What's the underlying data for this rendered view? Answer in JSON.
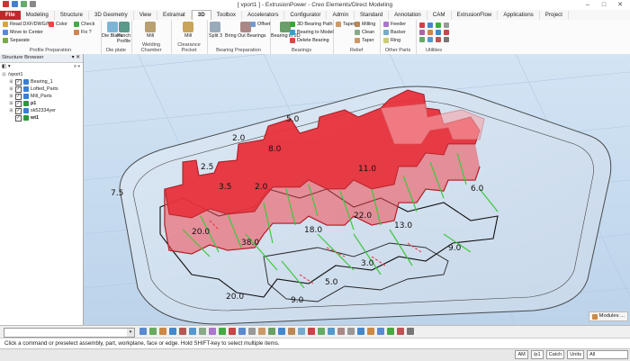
{
  "window": {
    "title": "[ vport1 ] - ExtrusionPower - Creo Elements/Direct Modeling",
    "controls": [
      "–",
      "□",
      "✕"
    ]
  },
  "menu_tabs": [
    "File",
    "Modeling",
    "Structure",
    "3D Geometry",
    "View",
    "Extramat",
    "3D",
    "Toolbox",
    "Accelerators",
    "Configurator",
    "Admin",
    "Standard",
    "Annotation",
    "CAM",
    "ExtrusionFlow",
    "Applications",
    "Project"
  ],
  "ribbon": {
    "profile_prep": {
      "label": "Profile Preparation",
      "items": [
        "Read DXF/DWG/MI",
        "Move to Center",
        "Separate"
      ],
      "color": "Color",
      "check": "Check",
      "fix": "Fix ?"
    },
    "die_plate": {
      "label": "Die plate",
      "buttons": [
        "Die Blank",
        "Punch Profile"
      ]
    },
    "welding": {
      "label": "Welding Chamber",
      "buttons": [
        "Mill"
      ]
    },
    "clearance": {
      "label": "Clearance Pocket",
      "buttons": [
        "Mill"
      ]
    },
    "bearing_prep": {
      "label": "Bearing Preparation",
      "buttons": [
        "Split 3",
        "Bring Out Bearings"
      ],
      "offset": "Offset"
    },
    "bearings": {
      "label": "Bearings",
      "items": [
        "3D Bearing Path",
        "Bearing to Model",
        "Delete Bearing"
      ],
      "button": "Bearing in 2D"
    },
    "relief": {
      "label": "Relief",
      "items": [
        "Taper",
        "Milling",
        "Clean",
        "Taper"
      ]
    },
    "other_parts": {
      "label": "Other Parts",
      "items": [
        "Feeder",
        "Backer",
        "Ring"
      ]
    },
    "utilities": {
      "label": "Utilities"
    }
  },
  "tree": {
    "title": "Structure Browser",
    "root": "/vport1",
    "items": [
      {
        "label": "Bearing_1",
        "checked": true
      },
      {
        "label": "Lofted_Parts",
        "checked": true
      },
      {
        "label": "Mill_Parts",
        "checked": true
      },
      {
        "label": "p1",
        "checked": true
      },
      {
        "label": "sk52334yer",
        "checked": true
      },
      {
        "label": "wt1",
        "checked": true
      }
    ]
  },
  "viewport": {
    "labels": [
      "5.0",
      "2.0",
      "8.0",
      "11.0",
      "6.0",
      "7.5",
      "2.5",
      "3.5",
      "2.0",
      "22.0",
      "18.0",
      "13.0",
      "20.0",
      "38.0",
      "9.0",
      "5.0",
      "9.0",
      "20.0",
      "3.0"
    ]
  },
  "modules_label": "Modules ...",
  "status": {
    "message": "Click a command or preselect assembly, part, workplane, face or edge. Hold SHIFT-key to select multiple items."
  },
  "lowerbar": {
    "items": [
      "AM",
      "/p1",
      "Catch",
      "Units",
      "All"
    ]
  },
  "colors": {
    "file_tab": "#c0272d",
    "part_red": "#e8323c",
    "bearing_green": "#3ec83e",
    "viewport_bg": "#c6dcef"
  }
}
